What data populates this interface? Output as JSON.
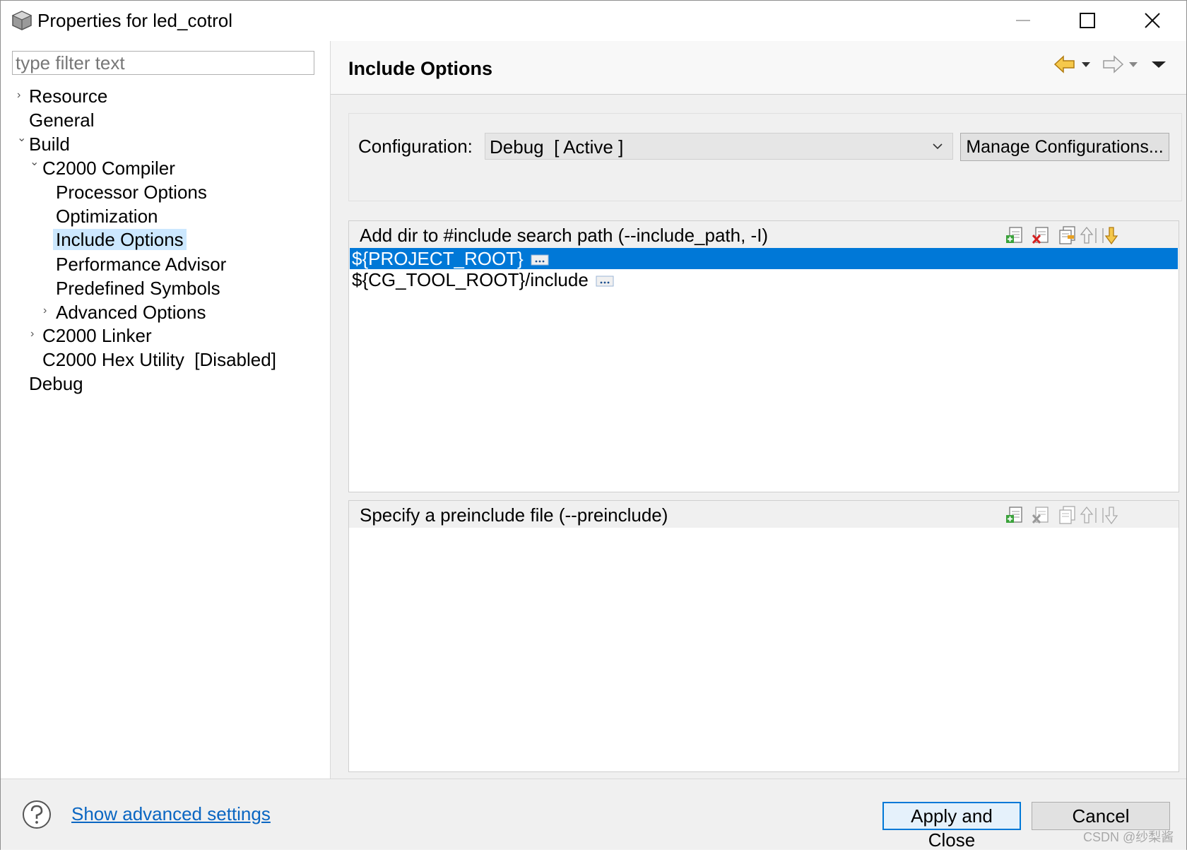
{
  "window": {
    "title": "Properties for led_cotrol",
    "controls": [
      "minimize",
      "maximize",
      "close"
    ]
  },
  "filter": {
    "placeholder": "type filter text"
  },
  "tree": {
    "items": [
      {
        "label": "Resource",
        "arrow": "›"
      },
      {
        "label": "General"
      },
      {
        "label": "Build",
        "arrow": "⌄"
      },
      {
        "label": "C2000 Compiler",
        "arrow": "⌄"
      },
      {
        "label": "Processor Options"
      },
      {
        "label": "Optimization"
      },
      {
        "label": "Include Options",
        "selected": true
      },
      {
        "label": "Performance Advisor"
      },
      {
        "label": "Predefined Symbols"
      },
      {
        "label": "Advanced Options",
        "arrow": "›"
      },
      {
        "label": "C2000 Linker",
        "arrow": "›"
      },
      {
        "label": "C2000 Hex Utility  [Disabled]"
      },
      {
        "label": "Debug"
      }
    ]
  },
  "page": {
    "title": "Include Options"
  },
  "config": {
    "label": "Configuration:",
    "value": "Debug  [ Active ]",
    "manage_label": "Manage Configurations..."
  },
  "include_paths": {
    "title": "Add dir to #include search path (--include_path, -I)",
    "items": [
      {
        "value": "${PROJECT_ROOT}",
        "selected": true
      },
      {
        "value": "${CG_TOOL_ROOT}/include",
        "selected": false
      }
    ]
  },
  "preinclude": {
    "title": "Specify a preinclude file (--preinclude)",
    "items": []
  },
  "footer": {
    "advanced_link": "Show advanced settings",
    "apply_label": "Apply and Close",
    "cancel_label": "Cancel",
    "watermark": "CSDN @纱梨酱"
  },
  "colors": {
    "selection": "#0078d7",
    "tree_selection": "#cce8ff",
    "link": "#0a66c2",
    "back_arrow": "#e8a020"
  },
  "icons": [
    "app-icon",
    "back-arrow-icon",
    "forward-arrow-icon",
    "menu-icon",
    "add-icon",
    "delete-icon",
    "edit-icon",
    "move-up-icon",
    "move-down-icon",
    "ellipsis-icon",
    "help-icon"
  ]
}
